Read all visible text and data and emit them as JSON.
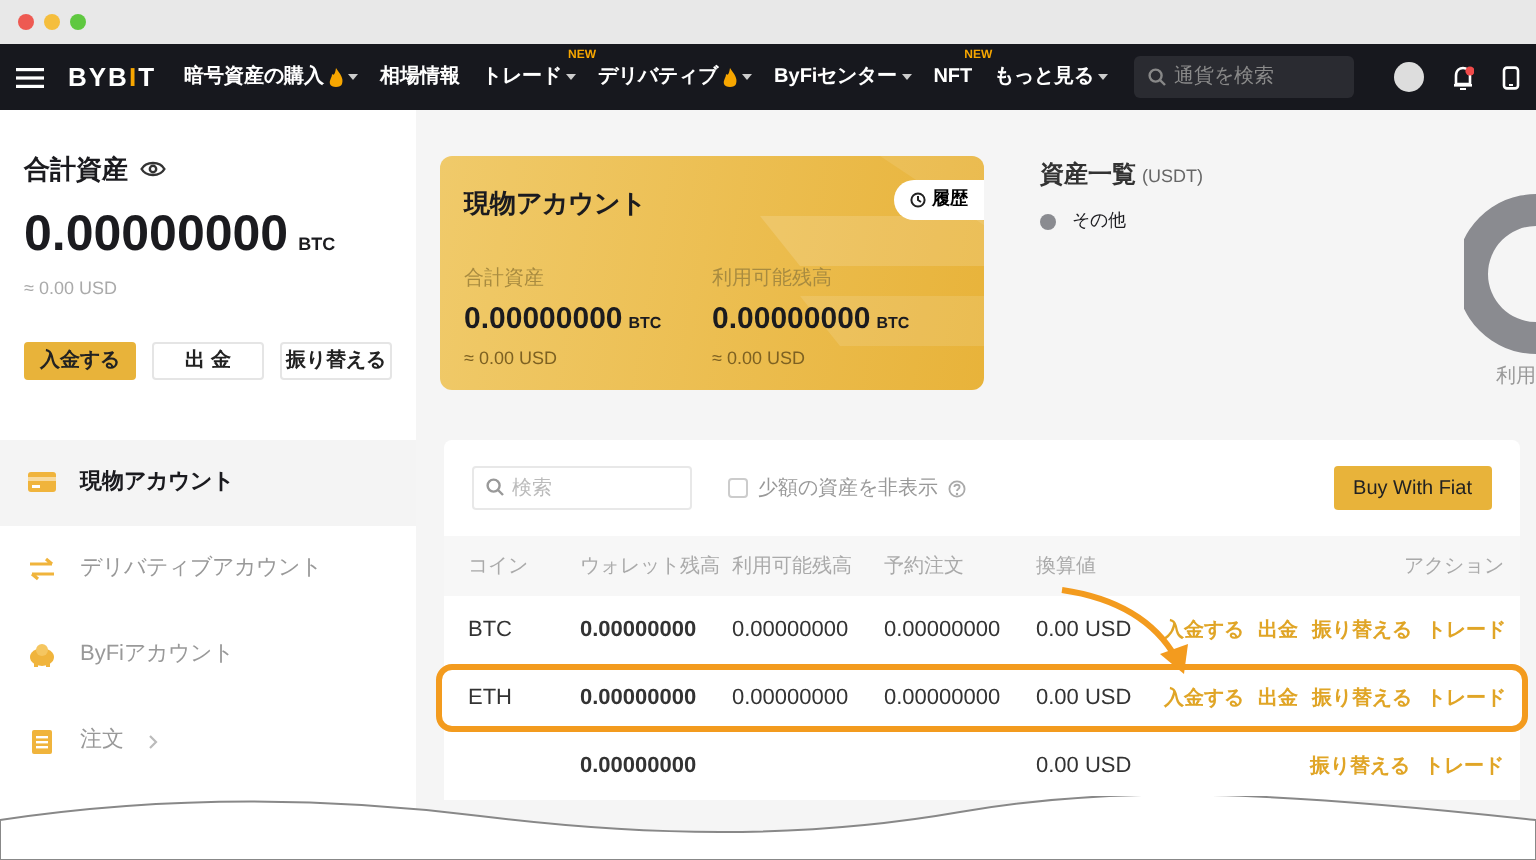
{
  "window": {
    "controls": [
      {
        "color": "#ee5a52"
      },
      {
        "color": "#f5be3d"
      },
      {
        "color": "#5fc840"
      }
    ]
  },
  "navbar": {
    "logo": "BYBIT",
    "items": [
      {
        "label": "暗号資産の購入",
        "hot": true,
        "dropdown": true
      },
      {
        "label": "相場情報",
        "hot": false,
        "dropdown": false
      },
      {
        "label": "トレード",
        "hot": false,
        "dropdown": true,
        "badge": "NEW"
      },
      {
        "label": "デリバティブ",
        "hot": true,
        "dropdown": true
      },
      {
        "label": "ByFiセンター",
        "hot": false,
        "dropdown": true
      },
      {
        "label": "NFT",
        "hot": false,
        "dropdown": false,
        "badge": "NEW"
      },
      {
        "label": "もっと見る",
        "hot": false,
        "dropdown": true
      }
    ],
    "search": {
      "placeholder": "通貨を検索"
    },
    "notifications": {
      "unread": true
    }
  },
  "summary": {
    "title": "合計資産",
    "amount": "0.00000000",
    "unit": "BTC",
    "usd": "≈ 0.00 USD",
    "buttons": [
      {
        "label": "入金する",
        "primary": true
      },
      {
        "label": "出 金",
        "primary": false
      },
      {
        "label": "振り替える",
        "primary": false
      }
    ]
  },
  "sidebar": {
    "items": [
      {
        "label": "現物アカウント",
        "kind": "card",
        "selected": true,
        "arrow": false
      },
      {
        "label": "デリバティブアカウント",
        "kind": "transfer",
        "selected": false,
        "arrow": false
      },
      {
        "label": "ByFiアカウント",
        "kind": "piggy",
        "selected": false,
        "arrow": false
      },
      {
        "label": "注文",
        "kind": "clipboard",
        "selected": false,
        "arrow": true
      }
    ]
  },
  "spot_card": {
    "title": "現物アカウント",
    "history_button": "履歴",
    "stats": [
      {
        "label": "合計資産",
        "amount": "0.00000000",
        "unit": "BTC",
        "usd": "≈ 0.00 USD"
      },
      {
        "label": "利用可能残高",
        "amount": "0.00000000",
        "unit": "BTC",
        "usd": "≈ 0.00 USD"
      }
    ]
  },
  "asset_overview": {
    "title": "資産一覧",
    "unit": "(USDT)",
    "legend": [
      {
        "label": "その他",
        "color": "#8a8b90"
      }
    ],
    "donut_label": "利用"
  },
  "assets": {
    "search_placeholder": "検索",
    "hide_small": {
      "label": "少額の資産を非表示",
      "checked": false
    },
    "buy_button": "Buy With Fiat",
    "columns": [
      "コイン",
      "ウォレット残高",
      "利用可能残高",
      "予約注文",
      "換算値",
      "アクション"
    ],
    "rows": [
      {
        "coin": "BTC",
        "wallet": "0.00000000",
        "available": "0.00000000",
        "reserved": "0.00000000",
        "value": "0.00 USD",
        "actions": [
          "入金する",
          "出金",
          "振り替える",
          "トレード"
        ],
        "highlighted": false
      },
      {
        "coin": "ETH",
        "wallet": "0.00000000",
        "available": "0.00000000",
        "reserved": "0.00000000",
        "value": "0.00 USD",
        "actions": [
          "入金する",
          "出金",
          "振り替える",
          "トレード"
        ],
        "highlighted": true
      },
      {
        "wallet": "0.00000000",
        "value": "0.00 USD",
        "actions": [
          "振り替える",
          "トレード"
        ],
        "highlighted": false
      }
    ]
  }
}
